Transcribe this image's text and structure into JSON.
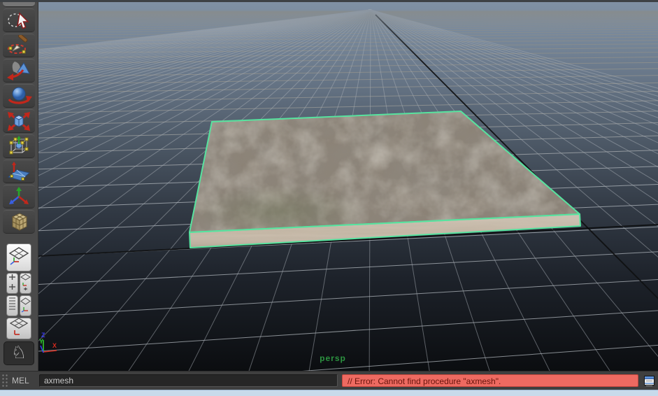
{
  "app": {
    "name": "Maya perspective viewport"
  },
  "toolbar": {
    "tools": [
      {
        "name": "lasso-select"
      },
      {
        "name": "paint-selection"
      },
      {
        "name": "move-tool"
      },
      {
        "name": "rotate-tool"
      },
      {
        "name": "scale-tool"
      },
      {
        "name": "universal-manipulator"
      },
      {
        "name": "soft-modification"
      },
      {
        "name": "show-manipulator"
      },
      {
        "name": "last-tool-used"
      }
    ],
    "layout_buttons": [
      {
        "name": "single-pane-layout",
        "active": true
      },
      {
        "name": "four-view-layout",
        "active": false
      },
      {
        "name": "outliner-persp-layout",
        "active": false
      },
      {
        "name": "persp-graph-layout",
        "active": false
      },
      {
        "name": "classic-toolbar",
        "active": false,
        "glyph": "♘"
      }
    ]
  },
  "viewport": {
    "camera_label": "persp",
    "axis_labels": {
      "x": "X",
      "y": "Y",
      "z": "Z"
    },
    "selected_object": "textured flat box (selected, green outline)"
  },
  "command_line": {
    "mode_label": "MEL",
    "input_value": "axmesh",
    "error_text": "// Error: Cannot find procedure \"axmesh\".",
    "script_editor_button": "script-editor"
  },
  "colors": {
    "selection_green": "#57e39f",
    "error_bg": "#ee6a61",
    "error_text": "#69140b",
    "sky_top": "#8091a4",
    "ground_bottom": "#0b0d10",
    "axis_x_red": "#d42a1e",
    "axis_y_green": "#2ecc2e",
    "axis_z_blue": "#3a3af0",
    "persp_label_green": "#2c9440",
    "grid_line_gray": "#b9c0c6",
    "grid_line_horizon_brown": "#97896c"
  }
}
